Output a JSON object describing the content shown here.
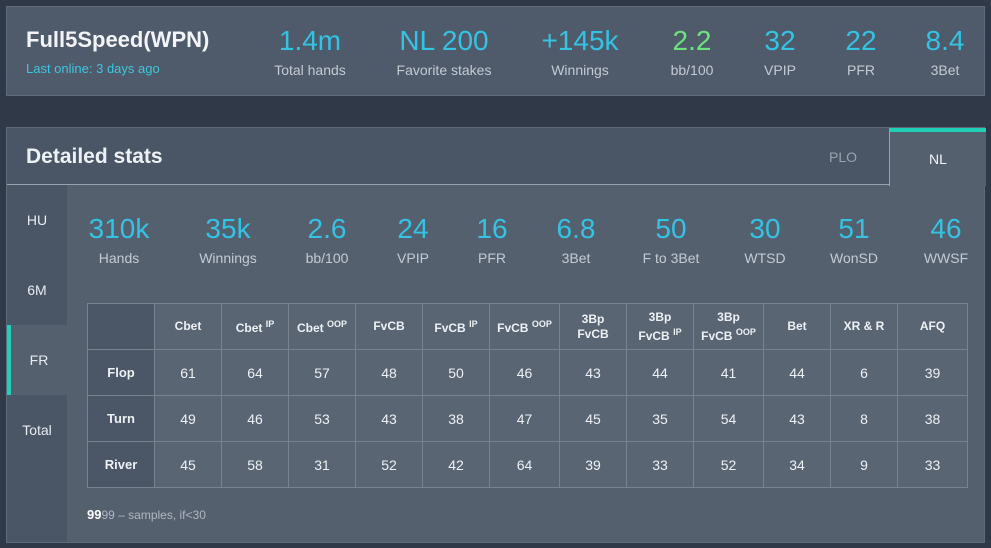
{
  "header": {
    "player_name": "Full5Speed(WPN)",
    "last_online": "Last online: 3 days ago",
    "stats": [
      {
        "value": "1.4m",
        "label": "Total hands"
      },
      {
        "value": "NL 200",
        "label": "Favorite stakes"
      },
      {
        "value": "+145k",
        "label": "Winnings"
      },
      {
        "value": "2.2",
        "label": "bb/100",
        "color": "#6de37e"
      },
      {
        "value": "32",
        "label": "VPIP"
      },
      {
        "value": "22",
        "label": "PFR"
      },
      {
        "value": "8.4",
        "label": "3Bet"
      }
    ]
  },
  "details": {
    "title": "Detailed stats",
    "tabs": [
      {
        "label": "PLO",
        "active": false
      },
      {
        "label": "NL",
        "active": true
      }
    ],
    "side_tabs": [
      {
        "label": "HU",
        "active": false
      },
      {
        "label": "6M",
        "active": false
      },
      {
        "label": "FR",
        "active": true
      },
      {
        "label": "Total",
        "active": false
      }
    ],
    "stats": [
      {
        "value": "310k",
        "label": "Hands"
      },
      {
        "value": "35k",
        "label": "Winnings"
      },
      {
        "value": "2.6",
        "label": "bb/100"
      },
      {
        "value": "24",
        "label": "VPIP"
      },
      {
        "value": "16",
        "label": "PFR"
      },
      {
        "value": "6.8",
        "label": "3Bet"
      },
      {
        "value": "50",
        "label": "F to 3Bet"
      },
      {
        "value": "30",
        "label": "WTSD"
      },
      {
        "value": "51",
        "label": "WonSD"
      },
      {
        "value": "46",
        "label": "WWSF"
      }
    ],
    "table": {
      "columns": [
        {
          "line1": "",
          "line2": "Cbet",
          "sup": ""
        },
        {
          "line1": "",
          "line2": "Cbet",
          "sup": "IP"
        },
        {
          "line1": "",
          "line2": "Cbet",
          "sup": "OOP"
        },
        {
          "line1": "",
          "line2": "FvCB",
          "sup": ""
        },
        {
          "line1": "",
          "line2": "FvCB",
          "sup": "IP"
        },
        {
          "line1": "",
          "line2": "FvCB",
          "sup": "OOP"
        },
        {
          "line1": "3Bp",
          "line2": "FvCB",
          "sup": ""
        },
        {
          "line1": "3Bp",
          "line2": "FvCB",
          "sup": "IP"
        },
        {
          "line1": "3Bp",
          "line2": "FvCB",
          "sup": "OOP"
        },
        {
          "line1": "",
          "line2": "Bet",
          "sup": ""
        },
        {
          "line1": "",
          "line2": "XR & R",
          "sup": ""
        },
        {
          "line1": "",
          "line2": "AFQ",
          "sup": ""
        }
      ],
      "rows": [
        {
          "label": "Flop",
          "cells": [
            "61",
            "64",
            "57",
            "48",
            "50",
            "46",
            "43",
            "44",
            "41",
            "44",
            "6",
            "39"
          ]
        },
        {
          "label": "Turn",
          "cells": [
            "49",
            "46",
            "53",
            "43",
            "38",
            "47",
            "45",
            "35",
            "54",
            "43",
            "8",
            "38"
          ]
        },
        {
          "label": "River",
          "cells": [
            "45",
            "58",
            "31",
            "52",
            "42",
            "64",
            "39",
            "33",
            "52",
            "34",
            "9",
            "33"
          ]
        }
      ]
    },
    "footnote": {
      "big": "99",
      "small": "99 – samples, if<30"
    }
  },
  "colors": {
    "accent": "#35c3e3",
    "positive": "#6de37e",
    "tab_indicator": "#1fd0b6"
  }
}
